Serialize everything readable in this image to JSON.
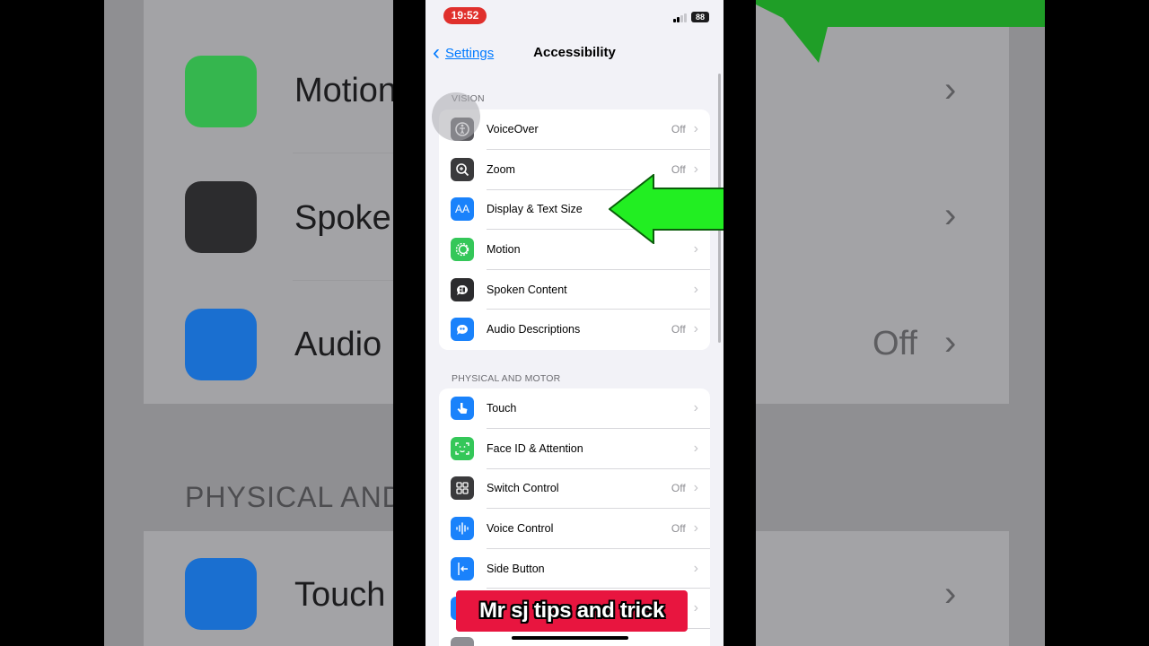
{
  "background_zoom": {
    "labels": [
      "Motion",
      "Spoke",
      "Audio",
      "Touch"
    ],
    "section": "PHYSICAL AND",
    "value_text": "Off"
  },
  "status_bar": {
    "time": "19:52",
    "battery": "88"
  },
  "nav": {
    "back_label": "Settings",
    "title": "Accessibility"
  },
  "sections": [
    {
      "header": "VISION",
      "rows": [
        {
          "label": "VoiceOver",
          "value": "Off",
          "icon": "voiceover-icon",
          "color": "#59595e"
        },
        {
          "label": "Zoom",
          "value": "Off",
          "icon": "zoom-icon",
          "color": "#3a3a3c"
        },
        {
          "label": "Display & Text Size",
          "value": "",
          "icon": "text-size-icon",
          "color": "#1a82fb"
        },
        {
          "label": "Motion",
          "value": "",
          "icon": "motion-icon",
          "color": "#34c759"
        },
        {
          "label": "Spoken Content",
          "value": "",
          "icon": "spoken-content-icon",
          "color": "#2c2c2e"
        },
        {
          "label": "Audio Descriptions",
          "value": "Off",
          "icon": "audio-descriptions-icon",
          "color": "#1a82fb"
        }
      ]
    },
    {
      "header": "PHYSICAL AND MOTOR",
      "rows": [
        {
          "label": "Touch",
          "value": "",
          "icon": "touch-icon",
          "color": "#1a82fb"
        },
        {
          "label": "Face ID & Attention",
          "value": "",
          "icon": "face-id-icon",
          "color": "#34c759"
        },
        {
          "label": "Switch Control",
          "value": "Off",
          "icon": "switch-control-icon",
          "color": "#3a3a3c"
        },
        {
          "label": "Voice Control",
          "value": "Off",
          "icon": "voice-control-icon",
          "color": "#1a82fb"
        },
        {
          "label": "Side Button",
          "value": "",
          "icon": "side-button-icon",
          "color": "#1a82fb"
        },
        {
          "label": "",
          "value": "",
          "icon": "app-icon",
          "color": "#1a82fb"
        },
        {
          "label": "",
          "value": "",
          "icon": "remote-icon",
          "color": "#8e8e93"
        }
      ]
    }
  ],
  "watermark": "Mr sj tips and trick",
  "colors": {
    "accent": "#007aff",
    "arrow": "#22ee22",
    "watermark_bg": "#e8153f",
    "time_pill": "#e0302c"
  }
}
